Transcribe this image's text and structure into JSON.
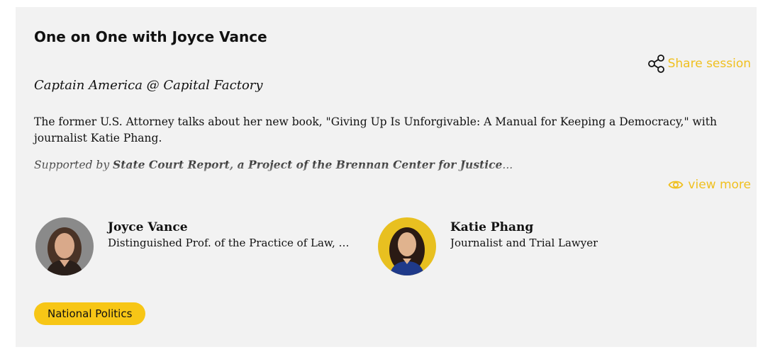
{
  "session": {
    "title": "One on One with Joyce Vance",
    "location": "Captain America @ Capital Factory",
    "description": "The former U.S. Attorney talks about her new book, \"Giving Up Is Unforgivable: A Manual for Keeping a Democracy,\" with journalist Katie Phang.",
    "supported_prefix": "Supported by ",
    "supported_sponsor": "State Court Report, a Project of the Brennan Center for Justice",
    "supported_suffix": "..."
  },
  "actions": {
    "share_label": "Share session",
    "view_more_label": "view more"
  },
  "speakers": [
    {
      "name": "Joyce Vance",
      "role": "Distinguished Prof. of the Practice of Law, University of Alabama"
    },
    {
      "name": "Katie Phang",
      "role": "Journalist and Trial Lawyer"
    }
  ],
  "tags": [
    "National Politics"
  ],
  "colors": {
    "accent": "#f0c020",
    "tag_bg": "#f7c616",
    "card_bg": "#f2f2f2"
  },
  "icons": {
    "share": "share-icon",
    "view_more": "eye-icon"
  }
}
